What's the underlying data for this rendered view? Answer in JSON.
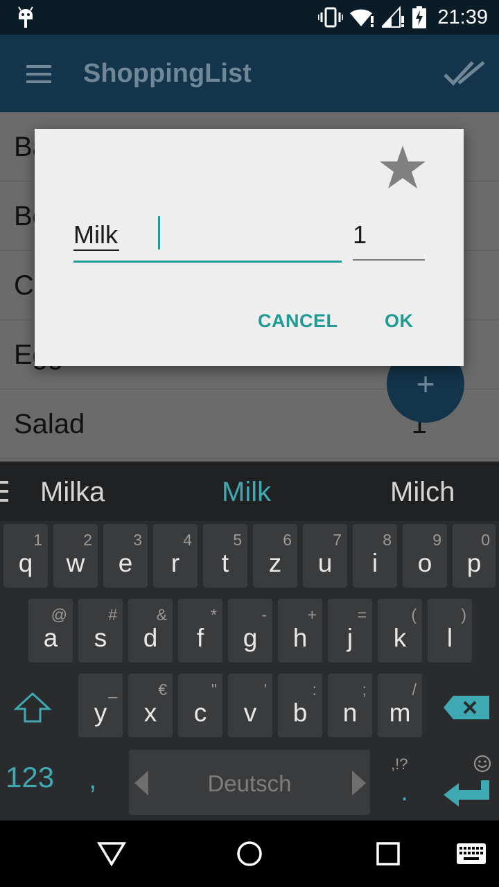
{
  "status_bar": {
    "time": "21:39"
  },
  "app_bar": {
    "title": "ShoppingList"
  },
  "list": {
    "items": [
      {
        "name": "Ba",
        "quantity": ""
      },
      {
        "name": "Be",
        "quantity": ""
      },
      {
        "name": "C",
        "quantity": ""
      },
      {
        "name": "Egg",
        "quantity": ""
      },
      {
        "name": "Salad",
        "quantity": "1"
      }
    ],
    "fab_label": "+"
  },
  "dialog": {
    "name_value": "Milk",
    "quantity_value": "1",
    "cancel_label": "CANCEL",
    "ok_label": "OK"
  },
  "keyboard": {
    "suggestions": [
      "Milka",
      "Milk",
      "Milch"
    ],
    "row1": [
      {
        "key": "q",
        "hint": "1"
      },
      {
        "key": "w",
        "hint": "2"
      },
      {
        "key": "e",
        "hint": "3"
      },
      {
        "key": "r",
        "hint": "4"
      },
      {
        "key": "t",
        "hint": "5"
      },
      {
        "key": "z",
        "hint": "6"
      },
      {
        "key": "u",
        "hint": "7"
      },
      {
        "key": "i",
        "hint": "8"
      },
      {
        "key": "o",
        "hint": "9"
      },
      {
        "key": "p",
        "hint": "0"
      }
    ],
    "row2": [
      {
        "key": "a",
        "hint": "@"
      },
      {
        "key": "s",
        "hint": "#"
      },
      {
        "key": "d",
        "hint": "&"
      },
      {
        "key": "f",
        "hint": "*"
      },
      {
        "key": "g",
        "hint": "-"
      },
      {
        "key": "h",
        "hint": "+"
      },
      {
        "key": "j",
        "hint": "="
      },
      {
        "key": "k",
        "hint": "("
      },
      {
        "key": "l",
        "hint": ")"
      }
    ],
    "row3": [
      {
        "key": "y",
        "hint": "_"
      },
      {
        "key": "x",
        "hint": "€"
      },
      {
        "key": "c",
        "hint": "\""
      },
      {
        "key": "v",
        "hint": "'"
      },
      {
        "key": "b",
        "hint": ":"
      },
      {
        "key": "n",
        "hint": ";"
      },
      {
        "key": "m",
        "hint": "/"
      }
    ],
    "numbers_label": "123",
    "comma": ",",
    "space_label": "Deutsch",
    "period": ".",
    "period_hint": ",!?"
  },
  "colors": {
    "accent": "#1f9a94",
    "app_bar": "#13344a",
    "dialog_bg": "#eeeeee"
  }
}
